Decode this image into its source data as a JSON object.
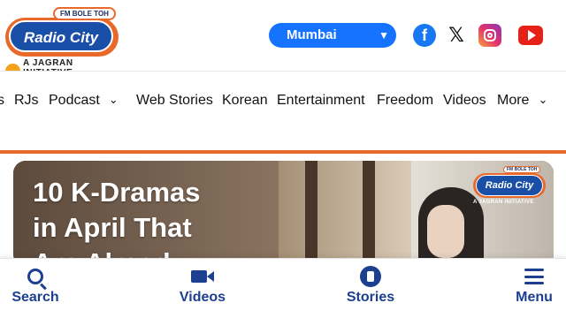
{
  "header": {
    "logo": {
      "tagline_top": "FM BOLE TOH",
      "brand": "Radio City",
      "sub": "A JAGRAN INITIATIVE"
    },
    "city_select": {
      "value": "Mumbai",
      "bg_color": "#1673ff"
    },
    "social_icons": [
      "facebook-icon",
      "x-icon",
      "instagram-icon",
      "youtube-icon"
    ]
  },
  "nav": {
    "items": [
      {
        "label": "s"
      },
      {
        "label": "RJs"
      },
      {
        "label": "Podcast"
      },
      {
        "label": "Web Stories"
      },
      {
        "label": "Korean"
      },
      {
        "label": "Entertainment"
      },
      {
        "label": "Freedom"
      },
      {
        "label": "Videos"
      },
      {
        "label": "More"
      }
    ],
    "accent_color": "#e8692a"
  },
  "hero": {
    "headline_line1": "10 K-Dramas",
    "headline_line2": "in April That",
    "headline_line3": "Are Already",
    "badge": {
      "tag": "FM BOLE TOH",
      "brand": "Radio City",
      "sub": "A JAGRAN INITIATIVE"
    }
  },
  "bottom_bar": {
    "items": [
      {
        "label": "Search",
        "icon": "search-icon"
      },
      {
        "label": "Videos",
        "icon": "video-icon"
      },
      {
        "label": "Stories",
        "icon": "stories-icon"
      },
      {
        "label": "Menu",
        "icon": "menu-icon"
      }
    ],
    "text_color": "#1d3f8f"
  }
}
